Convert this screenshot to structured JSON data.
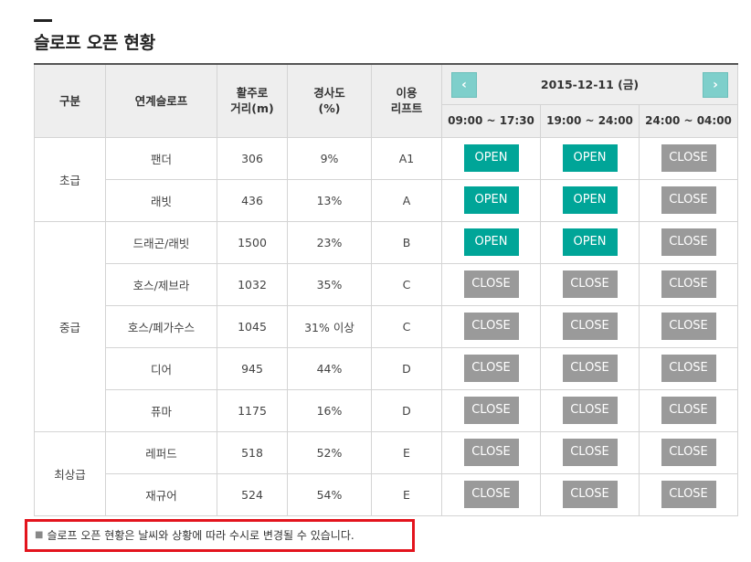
{
  "page_title": "슬로프 오픈 현황",
  "header": {
    "category": "구분",
    "linked_slope": "연계슬로프",
    "glide_distance": [
      "활주로",
      "거리(m)"
    ],
    "gradient": [
      "경사도",
      "(%)"
    ],
    "lift": [
      "이용",
      "리프트"
    ],
    "date": "2015-12-11 (금)",
    "prev_icon": "chevron-left-icon",
    "next_icon": "chevron-right-icon",
    "time_slots": [
      "09:00 ~ 17:30",
      "19:00 ~ 24:00",
      "24:00 ~ 04:00"
    ]
  },
  "groups": [
    {
      "level": "초급",
      "rows": [
        {
          "slope": "팬더",
          "distance": "306",
          "gradient": "9%",
          "lift": "A1",
          "status": [
            "OPEN",
            "OPEN",
            "CLOSE"
          ]
        },
        {
          "slope": "래빗",
          "distance": "436",
          "gradient": "13%",
          "lift": "A",
          "status": [
            "OPEN",
            "OPEN",
            "CLOSE"
          ]
        }
      ]
    },
    {
      "level": "중급",
      "rows": [
        {
          "slope": "드래곤/래빗",
          "distance": "1500",
          "gradient": "23%",
          "lift": "B",
          "status": [
            "OPEN",
            "OPEN",
            "CLOSE"
          ]
        },
        {
          "slope": "호스/제브라",
          "distance": "1032",
          "gradient": "35%",
          "lift": "C",
          "status": [
            "CLOSE",
            "CLOSE",
            "CLOSE"
          ]
        },
        {
          "slope": "호스/페가수스",
          "distance": "1045",
          "gradient": "31% 이상",
          "lift": "C",
          "status": [
            "CLOSE",
            "CLOSE",
            "CLOSE"
          ]
        },
        {
          "slope": "디어",
          "distance": "945",
          "gradient": "44%",
          "lift": "D",
          "status": [
            "CLOSE",
            "CLOSE",
            "CLOSE"
          ]
        },
        {
          "slope": "퓨마",
          "distance": "1175",
          "gradient": "16%",
          "lift": "D",
          "status": [
            "CLOSE",
            "CLOSE",
            "CLOSE"
          ]
        }
      ]
    },
    {
      "level": "최상급",
      "rows": [
        {
          "slope": "레퍼드",
          "distance": "518",
          "gradient": "52%",
          "lift": "E",
          "status": [
            "CLOSE",
            "CLOSE",
            "CLOSE"
          ]
        },
        {
          "slope": "재규어",
          "distance": "524",
          "gradient": "54%",
          "lift": "E",
          "status": [
            "CLOSE",
            "CLOSE",
            "CLOSE"
          ]
        }
      ]
    }
  ],
  "notice": "슬로프 오픈 현황은 날씨와 상황에 따라 수시로 변경될 수 있습니다.",
  "colors": {
    "open": "#00a598",
    "close": "#9a9a9a",
    "nav": "#7ecfcb",
    "notice_border": "#e3141d"
  }
}
